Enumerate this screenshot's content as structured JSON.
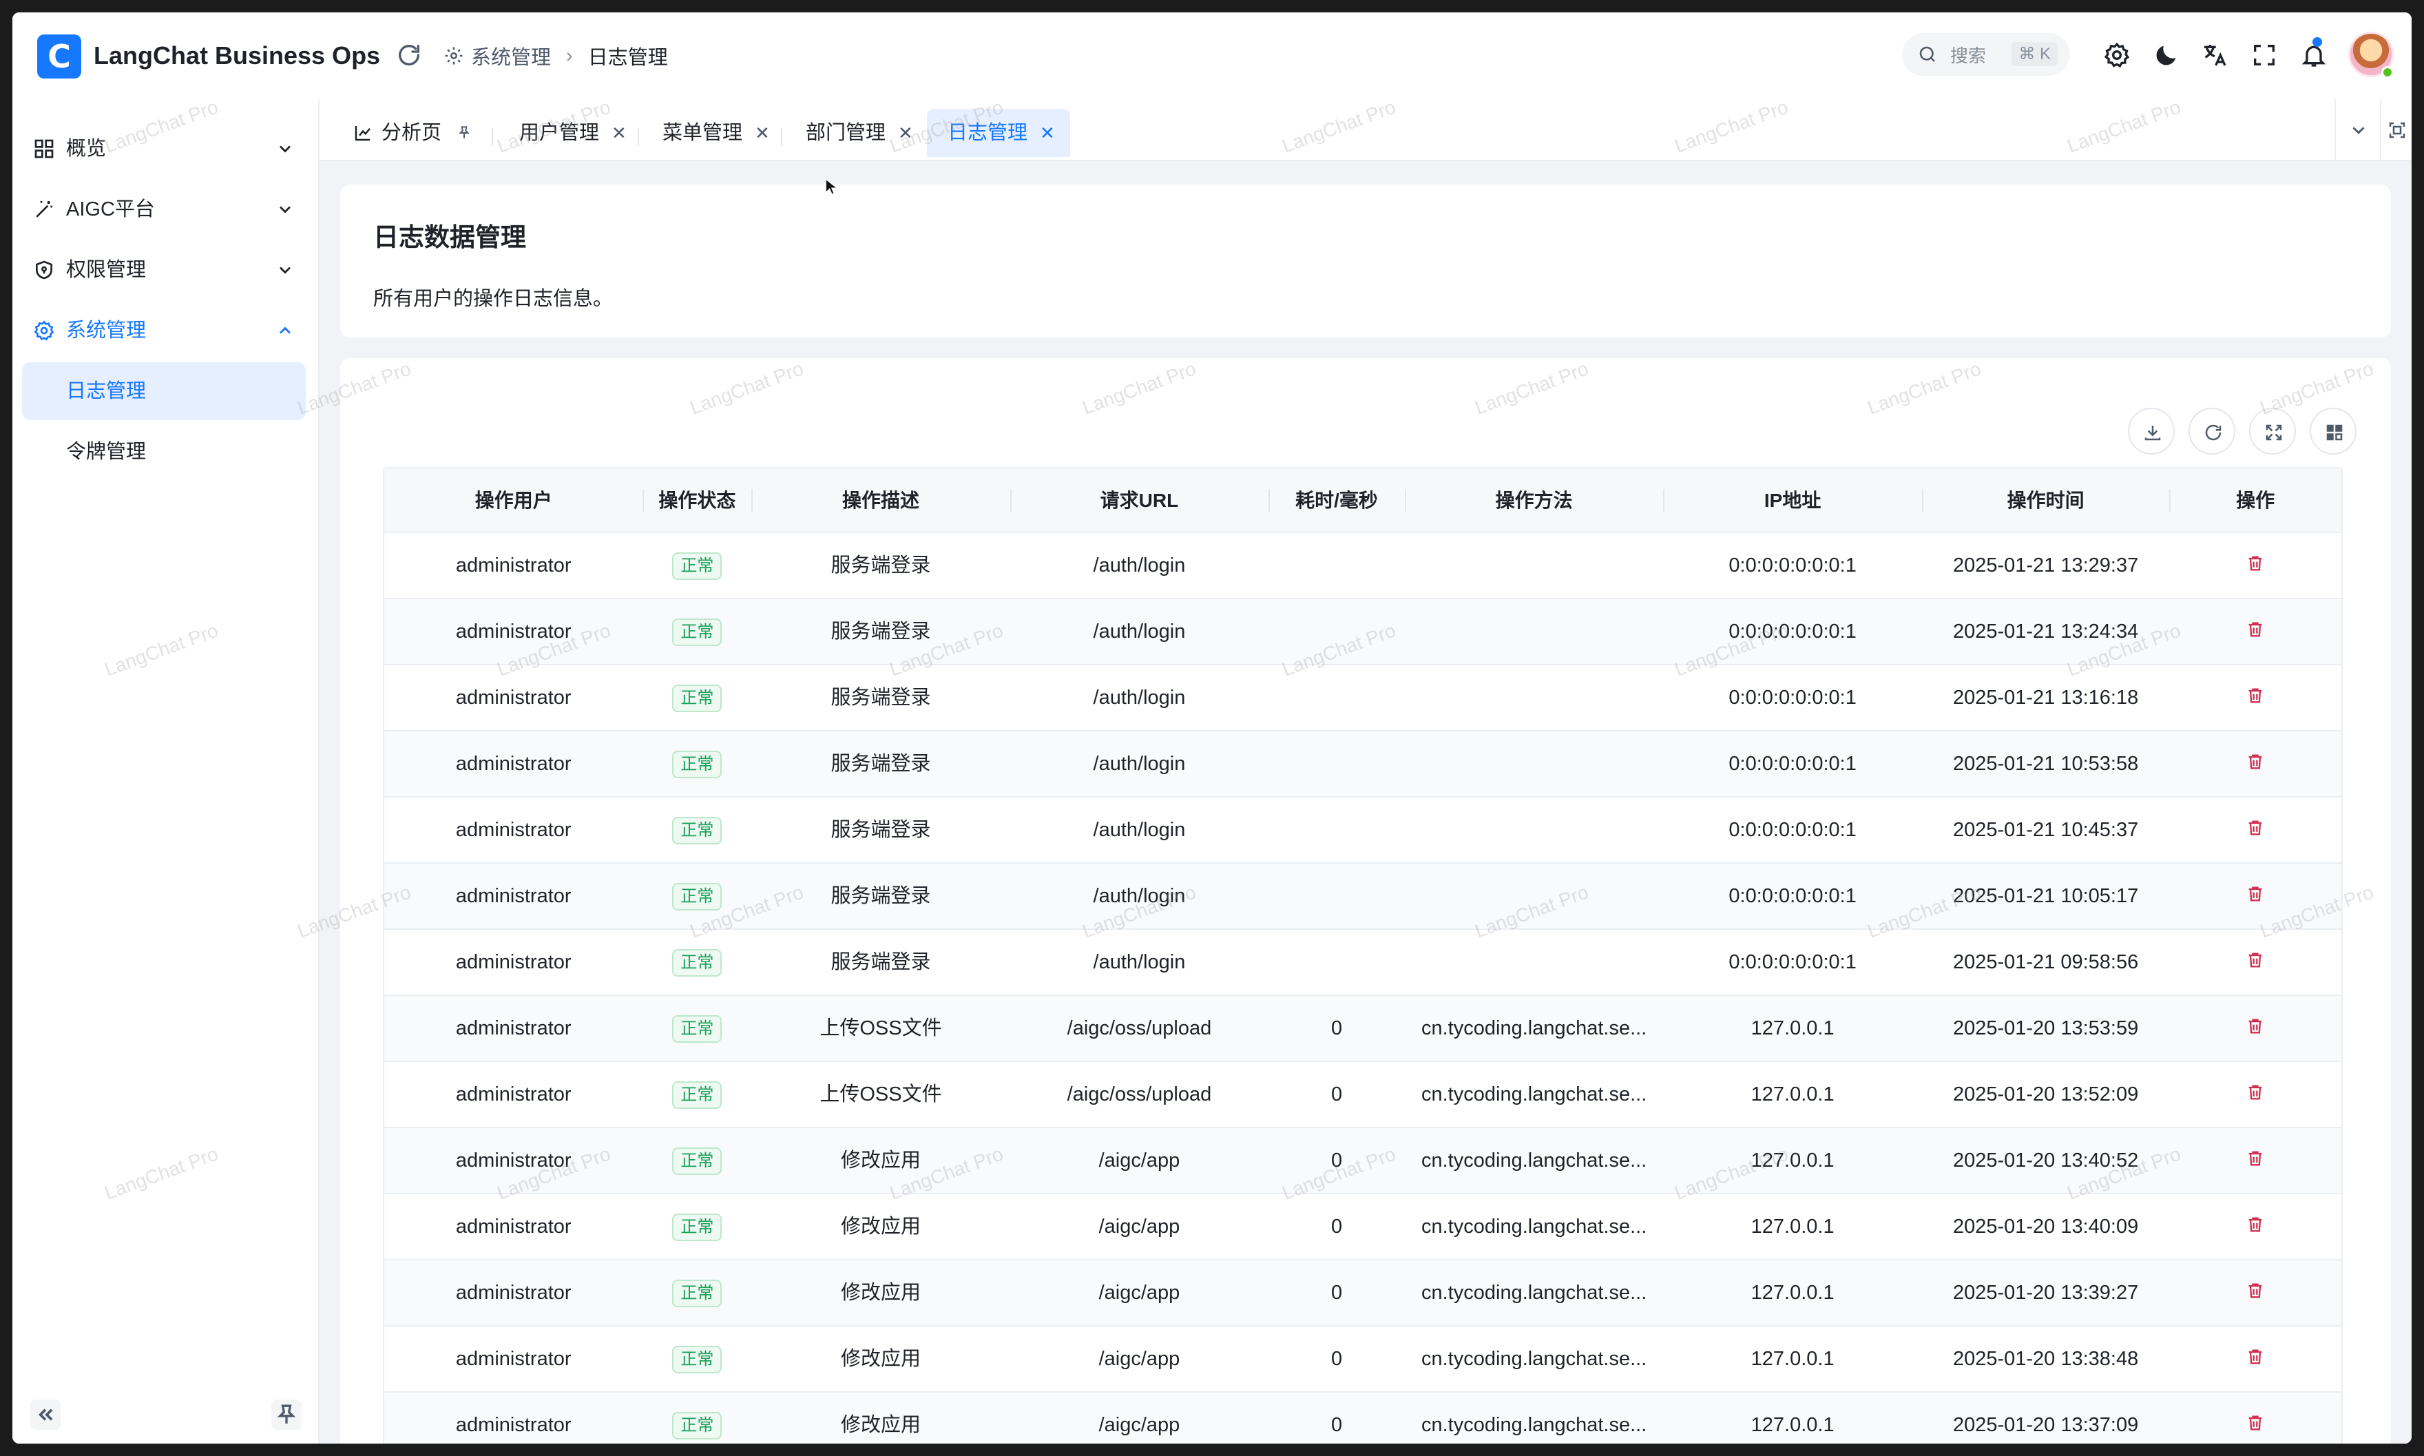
{
  "app": {
    "logo_letter": "C",
    "title": "LangChat Business Ops"
  },
  "breadcrumb": {
    "parent": "系统管理",
    "current": "日志管理"
  },
  "search": {
    "placeholder": "搜索",
    "shortcut": "⌘ K"
  },
  "sidebar": {
    "items": [
      {
        "label": "概览",
        "icon": "dashboard-icon",
        "expanded": false
      },
      {
        "label": "AIGC平台",
        "icon": "magic-wand-icon",
        "expanded": false
      },
      {
        "label": "权限管理",
        "icon": "shield-icon",
        "expanded": false
      },
      {
        "label": "系统管理",
        "icon": "gear-icon",
        "expanded": true
      }
    ],
    "sub_items": [
      {
        "label": "日志管理",
        "selected": true
      },
      {
        "label": "令牌管理",
        "selected": false
      }
    ]
  },
  "tabs": [
    {
      "label": "分析页",
      "pinned": true
    },
    {
      "label": "用户管理"
    },
    {
      "label": "菜单管理"
    },
    {
      "label": "部门管理"
    },
    {
      "label": "日志管理",
      "active": true
    }
  ],
  "page": {
    "title": "日志数据管理",
    "description": "所有用户的操作日志信息。"
  },
  "watermark": "LangChat Pro",
  "colors": {
    "accent": "#1677ff",
    "status_ok": "#18a058",
    "danger": "#d03050"
  },
  "table": {
    "columns": [
      "操作用户",
      "操作状态",
      "操作描述",
      "请求URL",
      "耗时/毫秒",
      "操作方法",
      "IP地址",
      "操作时间",
      "操作"
    ],
    "rows": [
      {
        "user": "administrator",
        "status": "正常",
        "desc": "服务端登录",
        "url": "/auth/login",
        "time_ms": "",
        "method": "",
        "ip": "0:0:0:0:0:0:0:1",
        "time": "2025-01-21 13:29:37"
      },
      {
        "user": "administrator",
        "status": "正常",
        "desc": "服务端登录",
        "url": "/auth/login",
        "time_ms": "",
        "method": "",
        "ip": "0:0:0:0:0:0:0:1",
        "time": "2025-01-21 13:24:34"
      },
      {
        "user": "administrator",
        "status": "正常",
        "desc": "服务端登录",
        "url": "/auth/login",
        "time_ms": "",
        "method": "",
        "ip": "0:0:0:0:0:0:0:1",
        "time": "2025-01-21 13:16:18"
      },
      {
        "user": "administrator",
        "status": "正常",
        "desc": "服务端登录",
        "url": "/auth/login",
        "time_ms": "",
        "method": "",
        "ip": "0:0:0:0:0:0:0:1",
        "time": "2025-01-21 10:53:58"
      },
      {
        "user": "administrator",
        "status": "正常",
        "desc": "服务端登录",
        "url": "/auth/login",
        "time_ms": "",
        "method": "",
        "ip": "0:0:0:0:0:0:0:1",
        "time": "2025-01-21 10:45:37"
      },
      {
        "user": "administrator",
        "status": "正常",
        "desc": "服务端登录",
        "url": "/auth/login",
        "time_ms": "",
        "method": "",
        "ip": "0:0:0:0:0:0:0:1",
        "time": "2025-01-21 10:05:17"
      },
      {
        "user": "administrator",
        "status": "正常",
        "desc": "服务端登录",
        "url": "/auth/login",
        "time_ms": "",
        "method": "",
        "ip": "0:0:0:0:0:0:0:1",
        "time": "2025-01-21 09:58:56"
      },
      {
        "user": "administrator",
        "status": "正常",
        "desc": "上传OSS文件",
        "url": "/aigc/oss/upload",
        "time_ms": "0",
        "method": "cn.tycoding.langchat.se...",
        "ip": "127.0.0.1",
        "time": "2025-01-20 13:53:59"
      },
      {
        "user": "administrator",
        "status": "正常",
        "desc": "上传OSS文件",
        "url": "/aigc/oss/upload",
        "time_ms": "0",
        "method": "cn.tycoding.langchat.se...",
        "ip": "127.0.0.1",
        "time": "2025-01-20 13:52:09"
      },
      {
        "user": "administrator",
        "status": "正常",
        "desc": "修改应用",
        "url": "/aigc/app",
        "time_ms": "0",
        "method": "cn.tycoding.langchat.se...",
        "ip": "127.0.0.1",
        "time": "2025-01-20 13:40:52"
      },
      {
        "user": "administrator",
        "status": "正常",
        "desc": "修改应用",
        "url": "/aigc/app",
        "time_ms": "0",
        "method": "cn.tycoding.langchat.se...",
        "ip": "127.0.0.1",
        "time": "2025-01-20 13:40:09"
      },
      {
        "user": "administrator",
        "status": "正常",
        "desc": "修改应用",
        "url": "/aigc/app",
        "time_ms": "0",
        "method": "cn.tycoding.langchat.se...",
        "ip": "127.0.0.1",
        "time": "2025-01-20 13:39:27"
      },
      {
        "user": "administrator",
        "status": "正常",
        "desc": "修改应用",
        "url": "/aigc/app",
        "time_ms": "0",
        "method": "cn.tycoding.langchat.se...",
        "ip": "127.0.0.1",
        "time": "2025-01-20 13:38:48"
      },
      {
        "user": "administrator",
        "status": "正常",
        "desc": "修改应用",
        "url": "/aigc/app",
        "time_ms": "0",
        "method": "cn.tycoding.langchat.se...",
        "ip": "127.0.0.1",
        "time": "2025-01-20 13:37:09"
      }
    ]
  }
}
